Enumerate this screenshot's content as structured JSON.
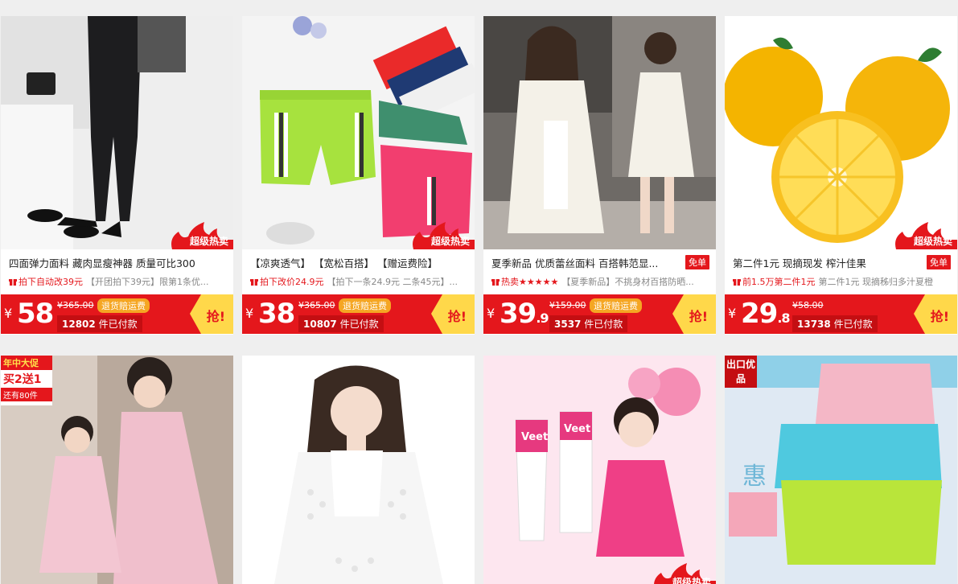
{
  "products": [
    {
      "title": "四面弹力面料  藏肉显瘦神器  质量可比300",
      "ship": "",
      "promo_em": "拍下自动改39元",
      "promo_sub": "【开团拍下39元】限第1条优...",
      "price_int": "58",
      "price_dec": "",
      "orig": "¥365.00",
      "badge": "退货赔运费",
      "sold_count": "12802",
      "sold_suffix": "件已付款",
      "hot": "超级热卖"
    },
    {
      "title": "【凉爽透气】  【宽松百搭】  【赠运费险】",
      "ship": "",
      "promo_em": "拍下改价24.9元",
      "promo_sub": "【拍下一条24.9元 二条45元】...",
      "price_int": "38",
      "price_dec": "",
      "orig": "¥365.00",
      "badge": "退货赔运费",
      "sold_count": "10807",
      "sold_suffix": "件已付款",
      "hot": "超级热卖"
    },
    {
      "title": "夏季新品  优质蕾丝面料  百搭韩范显...",
      "ship": "免单",
      "promo_em": "热卖★★★★★",
      "promo_sub": "【夏季新品】不挑身材百搭防晒...",
      "price_int": "39",
      "price_dec": ".9",
      "orig": "¥159.00",
      "badge": "退货赔运费",
      "sold_count": "3537",
      "sold_suffix": "件已付款",
      "hot": ""
    },
    {
      "title": "第二件1元  现摘现发  榨汁佳果",
      "ship": "免单",
      "promo_em": "前1.5万第二件1元",
      "promo_sub": "第二件1元 现摘秭归多汁夏橙",
      "price_int": "29",
      "price_dec": ".8",
      "orig": "¥58.00",
      "badge": "",
      "sold_count": "13738",
      "sold_suffix": "件已付款",
      "hot": "超级热卖"
    },
    {
      "sticker_top": "年中大促",
      "sticker_main": "买2送1",
      "sticker_sub": "还有80件"
    },
    {},
    {
      "brand": "Veet",
      "hot": "超级热卖"
    },
    {
      "tag": "出口优品",
      "side_char": "惠"
    }
  ],
  "currency": "¥",
  "grab_label": "抢!",
  "colors": {
    "accent_red": "#e4171c",
    "badge_orange": "#f5a623",
    "grab_yellow": "#ffd84a"
  }
}
